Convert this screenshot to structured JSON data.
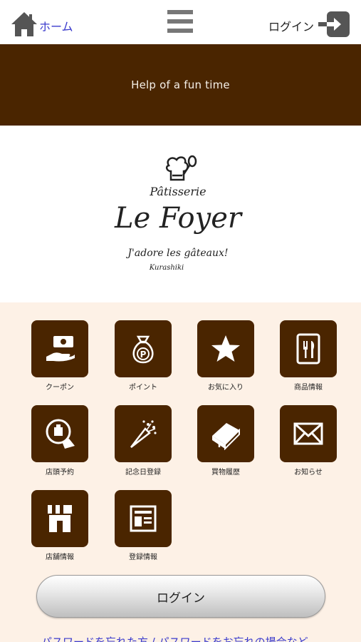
{
  "nav": {
    "home_label": "ホーム",
    "login_label": "ログイン"
  },
  "banner": {
    "text": "Help of a fun time"
  },
  "logo": {
    "line1": "Pâtisserie",
    "line2": "Le Foyer",
    "line3": "J'adore les gâteaux!",
    "line4": "Kurashiki"
  },
  "menu_items": [
    {
      "label": "クーポン",
      "icon": "coupon-icon"
    },
    {
      "label": "ポイント",
      "icon": "point-bag-icon"
    },
    {
      "label": "お気に入り",
      "icon": "star-icon"
    },
    {
      "label": "商品情報",
      "icon": "menu-fork-knife-icon"
    },
    {
      "label": "店頭予約",
      "icon": "reservation-icon"
    },
    {
      "label": "記念日登録",
      "icon": "bouquet-icon"
    },
    {
      "label": "買物履歴",
      "icon": "book-icon"
    },
    {
      "label": "お知らせ",
      "icon": "envelope-icon"
    },
    {
      "label": "店舗情報",
      "icon": "shop-icon"
    },
    {
      "label": "登録情報",
      "icon": "registration-form-icon"
    }
  ],
  "login_button": {
    "label": "ログイン"
  },
  "bottom_link": {
    "text": "パスワードを忘れた方 / パスワードをお忘れの場合など"
  },
  "colors": {
    "brown": "#4a2500",
    "background_cream": "#fdf1e6",
    "link": "#3a3acc"
  }
}
